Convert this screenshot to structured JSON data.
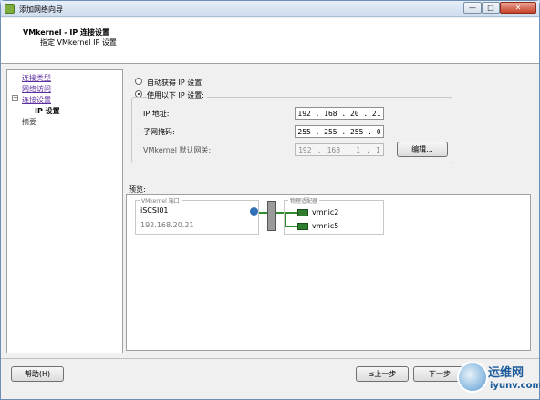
{
  "window": {
    "title": "添加网络向导",
    "min_label": "—",
    "max_label": "□",
    "close_label": "✕"
  },
  "header": {
    "title": "VMkernel - IP 连接设置",
    "subtitle": "指定 VMkernel IP 设置"
  },
  "nav": {
    "items": [
      {
        "label": "连接类型"
      },
      {
        "label": "网络访问"
      },
      {
        "label": "连接设置"
      },
      {
        "label": "IP 设置"
      },
      {
        "label": "摘要"
      }
    ],
    "expander": "−"
  },
  "ip_settings": {
    "option_auto": "自动获得 IP 设置",
    "option_manual": "使用以下 IP 设置:",
    "ip_label": "IP 地址:",
    "ip": [
      "192",
      "168",
      "20",
      "21"
    ],
    "mask_label": "子网掩码:",
    "mask": [
      "255",
      "255",
      "255",
      "0"
    ],
    "gateway_label": "VMkernel 默认网关:",
    "gateway": [
      "192",
      "168",
      "1",
      "1"
    ],
    "edit_button": "编辑..."
  },
  "preview": {
    "label": "预览:",
    "vmkernel_caption": "VMkernel 端口",
    "port_name": "iSCSI01",
    "port_ip": "192.168.20.21",
    "adapters_caption": "物理适配器",
    "adapters": [
      "vmnic2",
      "vmnic5"
    ]
  },
  "footer": {
    "help": "帮助(H)",
    "back": "≤上一步",
    "next": "下一步"
  },
  "watermark": {
    "line1": "运维网",
    "line2": "iyunv.com"
  },
  "colors": {
    "nav_link": "#5c2ea0",
    "nic_green": "#2e7d2e",
    "title_bar": "#cfddef"
  }
}
